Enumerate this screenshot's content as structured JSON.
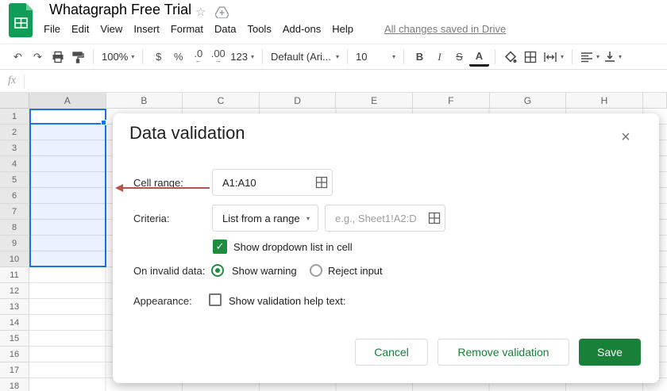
{
  "header": {
    "doc_title": "Whatagraph Free Trial",
    "menu_items": [
      "File",
      "Edit",
      "View",
      "Insert",
      "Format",
      "Data",
      "Tools",
      "Add-ons",
      "Help"
    ],
    "saved_status": "All changes saved in Drive"
  },
  "icons": {
    "star": "☆",
    "undo": "↶",
    "redo": "↷",
    "caret_down": "▾",
    "close": "×",
    "check": "✓",
    "dec_left_arrow": "←",
    "dec_right_arrow": "→"
  },
  "toolbar": {
    "zoom_value": "100%",
    "currency_label": "$",
    "percent_label": "%",
    "decrease_decimal_label": ".0",
    "increase_decimal_label": ".00",
    "more_formats_label": "123",
    "font_name": "Default (Ari...",
    "font_size": "10",
    "bold_label": "B",
    "italic_label": "I",
    "strikethrough_label": "S",
    "text_color_label": "A"
  },
  "formula_bar": {
    "fx_label": "fx",
    "value": ""
  },
  "sheet": {
    "columns": [
      "A",
      "B",
      "C",
      "D",
      "E",
      "F",
      "G",
      "H"
    ],
    "rows": [
      "1",
      "2",
      "3",
      "4",
      "5",
      "6",
      "7",
      "8",
      "9",
      "10",
      "11",
      "12",
      "13",
      "14",
      "15",
      "16",
      "17",
      "18"
    ],
    "selection": {
      "range": "A1:A10",
      "col": "A",
      "row_start": 1,
      "row_end": 10
    }
  },
  "dialog": {
    "title": "Data validation",
    "cell_range": {
      "label": "Cell range:",
      "value": "A1:A10"
    },
    "criteria": {
      "label": "Criteria:",
      "selected_option": "List from a range",
      "range_placeholder": "e.g., Sheet1!A2:D"
    },
    "show_dropdown": {
      "label": "Show dropdown list in cell",
      "checked": true
    },
    "on_invalid": {
      "label": "On invalid data:",
      "options": [
        {
          "label": "Show warning",
          "selected": true
        },
        {
          "label": "Reject input",
          "selected": false
        }
      ]
    },
    "appearance": {
      "label": "Appearance:",
      "checkbox_label": "Show validation help text:",
      "checked": false
    },
    "buttons": {
      "cancel": "Cancel",
      "remove": "Remove validation",
      "save": "Save"
    }
  },
  "colors": {
    "logo_green": "#0f9d58",
    "selection_blue": "#1a73e8",
    "checkbox_green": "#1e8e3e",
    "button_green": "#188038",
    "annotation_arrow_red": "#b5544a"
  }
}
